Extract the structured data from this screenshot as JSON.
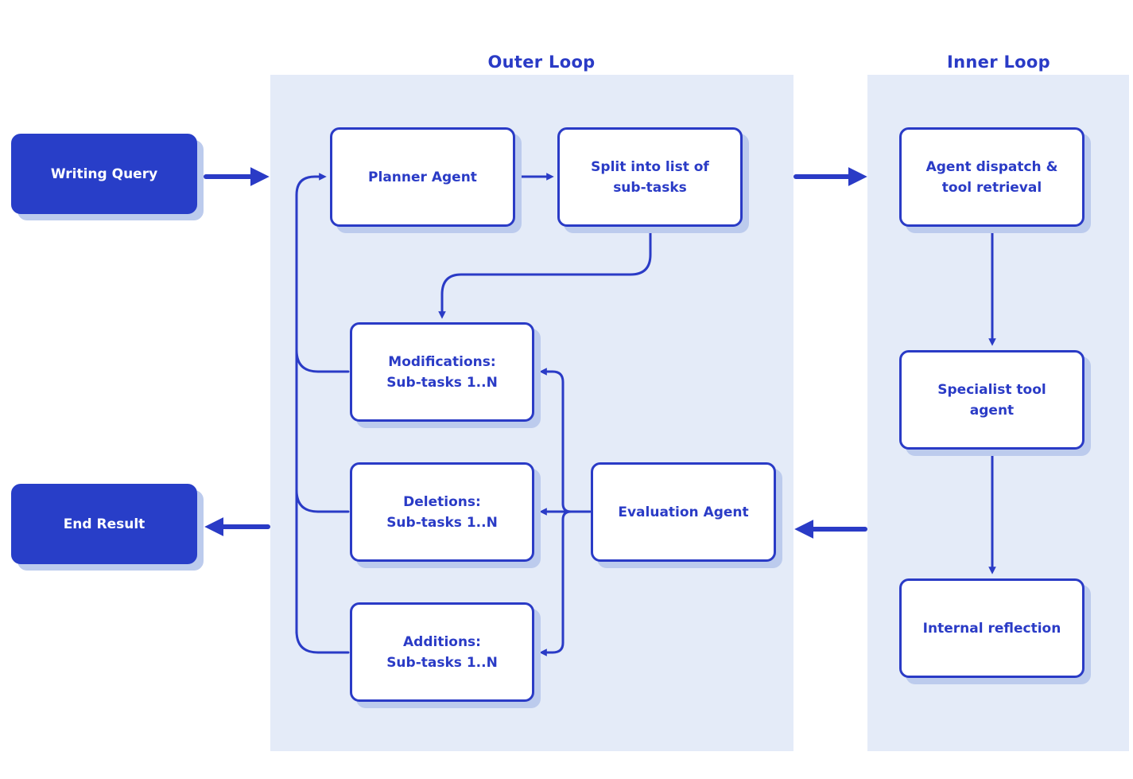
{
  "colors": {
    "accent": "#2a3bc6",
    "panel": "#e4ebf8",
    "shadow": "#bccbed",
    "solid_node": "#283ec8"
  },
  "panels": {
    "outer": {
      "title": "Outer Loop"
    },
    "inner": {
      "title": "Inner Loop"
    }
  },
  "nodes": {
    "writing_query": "Writing Query",
    "end_result": "End Result",
    "planner_agent": "Planner Agent",
    "split_subtasks": "Split into list of\nsub-tasks",
    "modifications": "Modifications:\nSub-tasks 1..N",
    "deletions": "Deletions:\nSub-tasks 1..N",
    "additions": "Additions:\nSub-tasks 1..N",
    "evaluation_agent": "Evaluation Agent",
    "agent_dispatch": "Agent dispatch &\ntool retrieval",
    "specialist_tool": "Specialist tool\nagent",
    "internal_reflection": "Internal reflection"
  },
  "edges": [
    {
      "from": "Writing Query",
      "to": "Outer Loop"
    },
    {
      "from": "Planner Agent",
      "to": "Split into list of sub-tasks"
    },
    {
      "from": "Split into list of sub-tasks",
      "to": "Modifications: Sub-tasks 1..N"
    },
    {
      "from": "Outer Loop",
      "to": "Inner Loop"
    },
    {
      "from": "Agent dispatch & tool retrieval",
      "to": "Specialist tool agent"
    },
    {
      "from": "Specialist tool agent",
      "to": "Internal reflection"
    },
    {
      "from": "Inner Loop",
      "to": "Evaluation Agent"
    },
    {
      "from": "Evaluation Agent",
      "to": "Modifications: Sub-tasks 1..N"
    },
    {
      "from": "Evaluation Agent",
      "to": "Deletions: Sub-tasks 1..N"
    },
    {
      "from": "Evaluation Agent",
      "to": "Additions: Sub-tasks 1..N"
    },
    {
      "from": "Modifications / Deletions / Additions",
      "to": "Planner Agent"
    },
    {
      "from": "Outer Loop",
      "to": "End Result"
    }
  ]
}
